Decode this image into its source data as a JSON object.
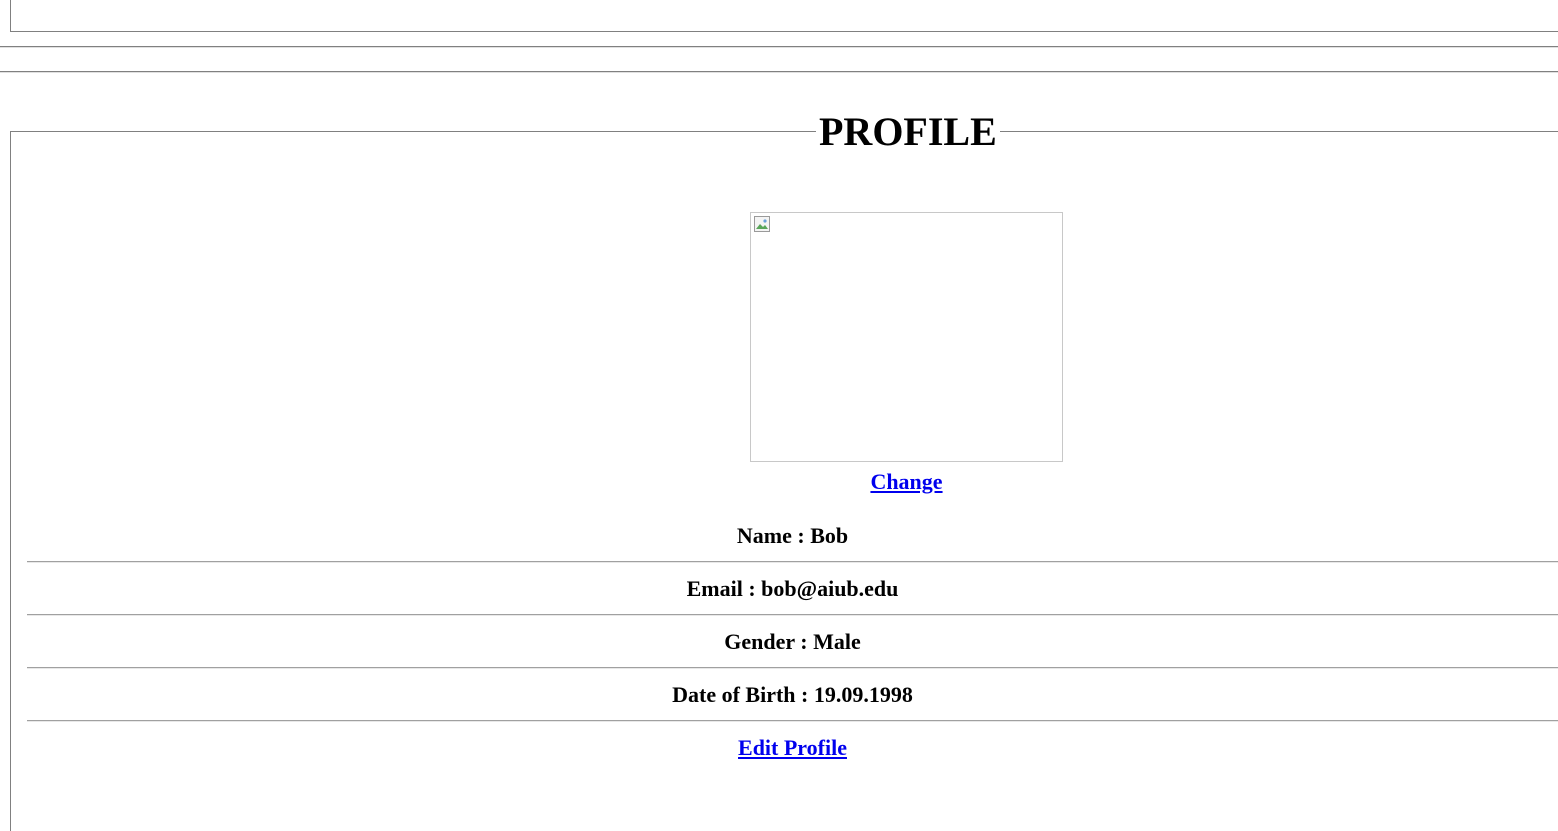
{
  "profile": {
    "title": "PROFILE",
    "change_label": "Change",
    "fields": {
      "name": "Name : Bob",
      "email": "Email : bob@aiub.edu",
      "gender": "Gender : Male",
      "dob": "Date of Birth : 19.09.1998"
    },
    "edit_label": "Edit Profile"
  },
  "icons": {
    "avatar_placeholder": "broken-image-icon"
  },
  "colors": {
    "link": "#0000ee",
    "border": "#808080"
  }
}
